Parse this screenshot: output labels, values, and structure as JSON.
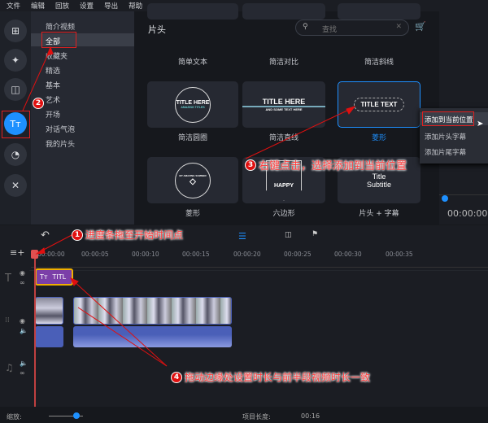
{
  "menu": [
    "文件",
    "编辑",
    "回放",
    "设置",
    "导出",
    "帮助"
  ],
  "rail": [
    {
      "icon": "import-icon",
      "glyph": "⊞"
    },
    {
      "icon": "magic-wand-icon",
      "glyph": "✦"
    },
    {
      "icon": "transition-icon",
      "glyph": "◫"
    },
    {
      "icon": "titles-icon",
      "glyph": "Tт"
    },
    {
      "icon": "sticker-icon",
      "glyph": "◔"
    },
    {
      "icon": "tools-icon",
      "glyph": "✕"
    }
  ],
  "categories": [
    "简介视频",
    "全部",
    "收藏夹",
    "精选",
    "基本",
    "艺术",
    "开场",
    "对话气泡",
    "我的片头"
  ],
  "main": {
    "title": "片头",
    "search_placeholder": "查找",
    "cards": [
      {
        "label": "简单文本"
      },
      {
        "label": "简洁对比"
      },
      {
        "label": "简洁斜线"
      },
      {
        "label": "简洁圆圈",
        "art": "TITLE HERE",
        "sub": "AMAZING TITLES"
      },
      {
        "label": "简洁直线",
        "art": "TITLE HERE",
        "sub": "AND SOME TEXT HERE"
      },
      {
        "label": "菱形",
        "art": "TITLE TEXT"
      },
      {
        "label": "菱形",
        "art": "MY AMAZING SUMMER"
      },
      {
        "label": "六边形",
        "art": "HAPPY"
      },
      {
        "label": "片头 + 字幕",
        "art": "Title",
        "sub": "Subtitle"
      }
    ]
  },
  "context_menu": [
    "添加到当前位置",
    "添加片头字幕",
    "添加片尾字幕"
  ],
  "preview": {
    "time": "00:00:00"
  },
  "timeline": {
    "ticks": [
      "00:00:00",
      "00:00:05",
      "00:00:10",
      "00:00:15",
      "00:00:20",
      "00:00:25",
      "00:00:30",
      "00:00:35"
    ],
    "title_clip": "TITL",
    "zoom_label": "缩放:",
    "zoom_level": 0.35,
    "project_length_label": "项目长度:",
    "project_length": "00:16"
  },
  "annotations": [
    {
      "n": "1",
      "text": "进度条拖至开始时间点"
    },
    {
      "n": "2"
    },
    {
      "n": "3",
      "text": "右键点击，选择添加到当前位置"
    },
    {
      "n": "4",
      "text": "拖动边缘处设置时长与前半段视频时长一致"
    }
  ],
  "colors": {
    "accent": "#1e90ff",
    "annotation": "#e01010",
    "title_clip": "#7b3fa8",
    "video_clip": "#4a5fb8"
  }
}
